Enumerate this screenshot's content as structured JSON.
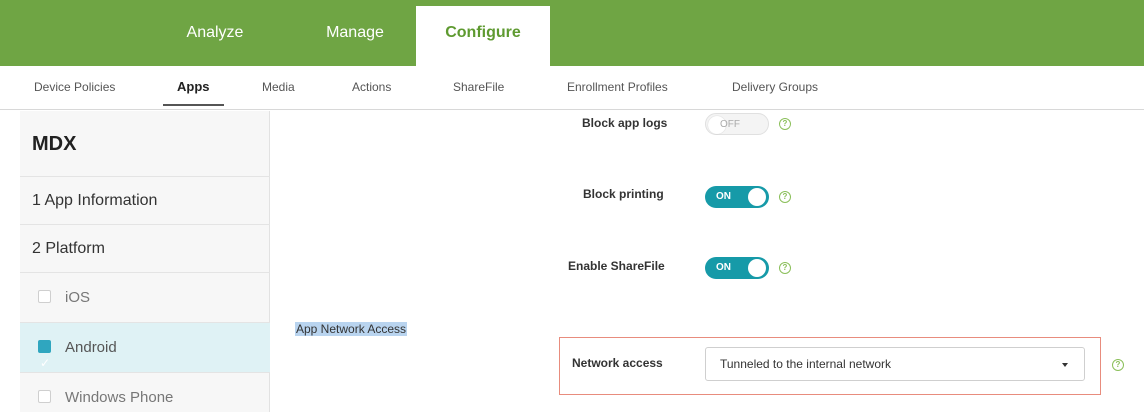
{
  "top_nav": {
    "tabs": [
      {
        "label": "Analyze"
      },
      {
        "label": "Manage"
      },
      {
        "label": "Configure"
      }
    ],
    "active": "Configure"
  },
  "sub_nav": {
    "items": [
      {
        "label": "Device Policies"
      },
      {
        "label": "Apps"
      },
      {
        "label": "Media"
      },
      {
        "label": "Actions"
      },
      {
        "label": "ShareFile"
      },
      {
        "label": "Enrollment Profiles"
      },
      {
        "label": "Delivery Groups"
      }
    ],
    "active": "Apps"
  },
  "left_panel": {
    "title": "MDX",
    "steps": [
      {
        "label": "1 App Information"
      },
      {
        "label": "2 Platform"
      }
    ],
    "platforms": [
      {
        "label": "iOS",
        "checked": false
      },
      {
        "label": "Android",
        "checked": true
      },
      {
        "label": "Windows Phone",
        "checked": false
      }
    ]
  },
  "settings": {
    "block_app_logs": {
      "label": "Block app logs",
      "state": "OFF"
    },
    "block_printing": {
      "label": "Block printing",
      "state": "ON"
    },
    "enable_sharefile": {
      "label": "Enable ShareFile",
      "state": "ON"
    },
    "section_label": "App Network Access",
    "network_access": {
      "label": "Network access",
      "value": "Tunneled to the internal network"
    },
    "help_glyph": "?"
  },
  "colors": {
    "topbar": "#6fa544",
    "active_tab_text": "#5e9a30",
    "toggle_on": "#169aa8",
    "selected_platform_bg": "#dff2f5",
    "highlight_border": "#e88c7d"
  }
}
